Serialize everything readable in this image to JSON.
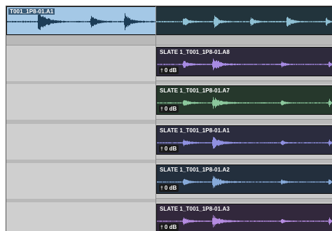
{
  "main_clip": {
    "name": "T001_1P8-01.A1",
    "wave_left": "#1d3d57",
    "wave_right": "#8fc0d4",
    "bg_selected": "#a4c8e6",
    "bg": "#22343c"
  },
  "slate_clips": [
    {
      "name": "SLATE 1_T001_1P8-01.A8",
      "gain": "0 dB",
      "bg": "#2e2a3c",
      "wave": "#a78be3"
    },
    {
      "name": "SLATE 1_T001_1P8-01.A7",
      "gain": "0 dB",
      "bg": "#26382c",
      "wave": "#8bc79c"
    },
    {
      "name": "SLATE 1_T001_1P8-01.A1",
      "gain": "0 dB",
      "bg": "#2b2c3e",
      "wave": "#8f90e0"
    },
    {
      "name": "SLATE 1_T001_1P8-01.A2",
      "gain": "0 dB",
      "bg": "#232f3d",
      "wave": "#86a9d8"
    },
    {
      "name": "SLATE 1_T001_1P8-01.A3",
      "gain": "0 dB",
      "bg": "#32283c",
      "wave": "#b48be0"
    }
  ],
  "icons": {
    "gain": "clip-gain-icon"
  }
}
